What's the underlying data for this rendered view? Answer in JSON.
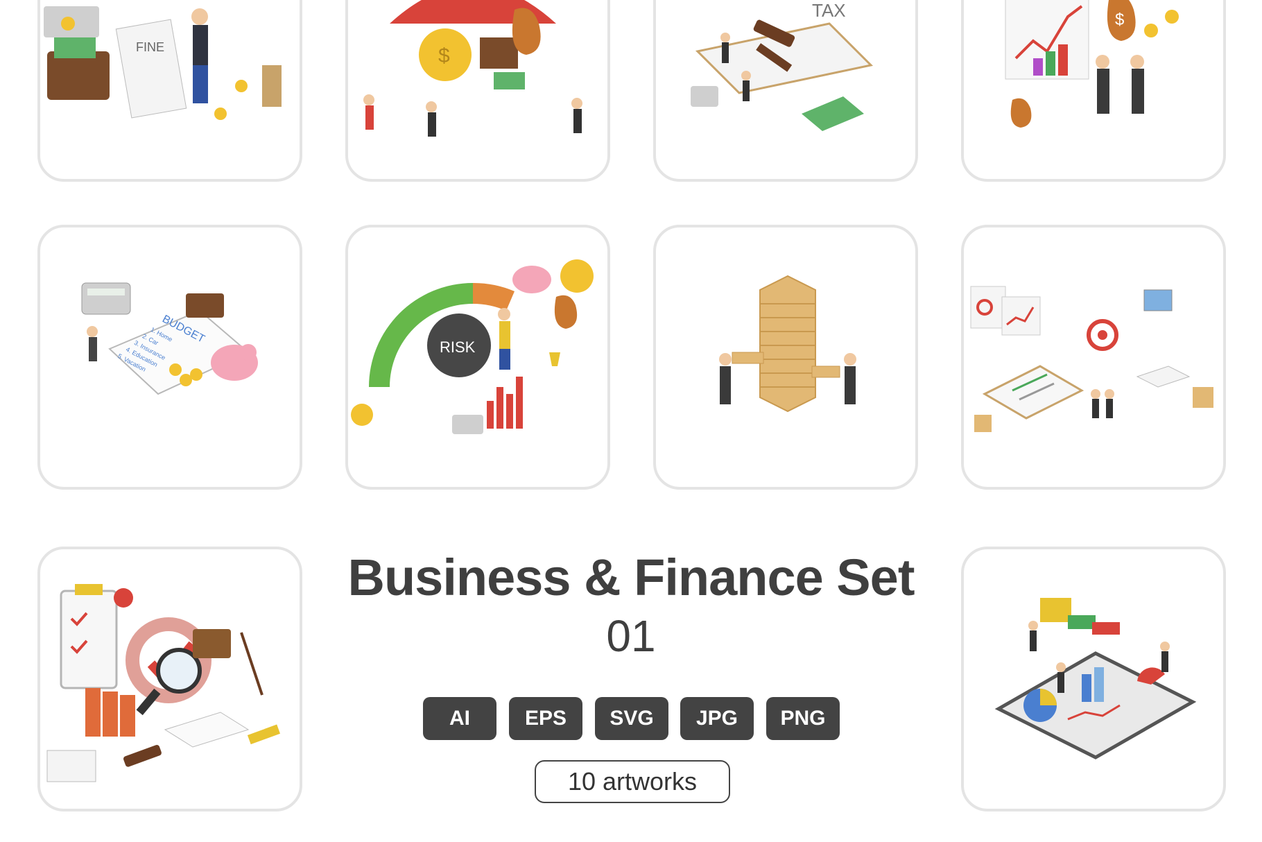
{
  "title": "Business & Finance Set",
  "subtitle": "01",
  "formats": [
    "AI",
    "EPS",
    "SVG",
    "JPG",
    "PNG"
  ],
  "artworks_count": "10 artworks",
  "cards": [
    {
      "label": "FINE"
    },
    {
      "label": "$"
    },
    {
      "label": "TAX"
    },
    {
      "label": "$"
    },
    {
      "label": "BUDGET",
      "list": [
        "1. Home",
        "2. Car",
        "3. Insurance",
        "4. Education",
        "5. Vacation"
      ]
    },
    {
      "label": "RISK"
    },
    {
      "label": ""
    },
    {
      "label": ""
    },
    {
      "label": ""
    },
    {
      "label": ""
    }
  ],
  "colors": {
    "text": "#3f3f3f",
    "chip": "#434343",
    "card_border": "#e4e4e4",
    "coin": "#f2c230",
    "red": "#d8433a",
    "green": "#4aa85a",
    "wood": "#e2b874"
  }
}
